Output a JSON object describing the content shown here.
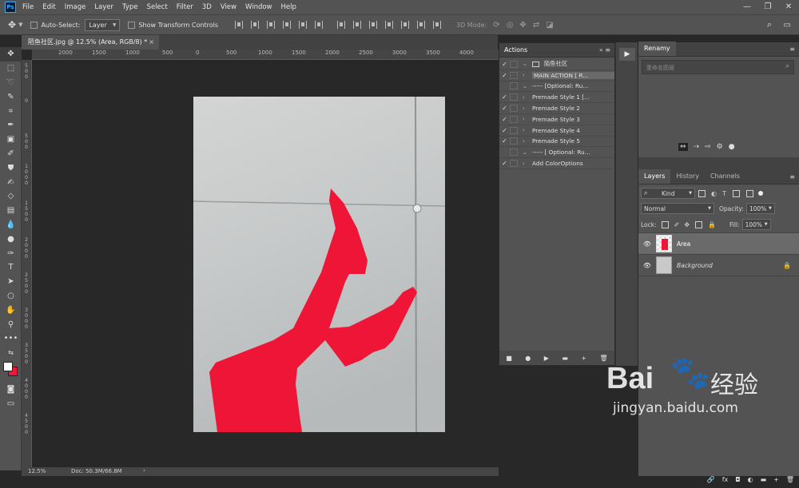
{
  "app": {
    "logo": "Ps"
  },
  "menubar": [
    "File",
    "Edit",
    "Image",
    "Layer",
    "Type",
    "Select",
    "Filter",
    "3D",
    "View",
    "Window",
    "Help"
  ],
  "window_controls": [
    "—",
    "❐",
    "✕"
  ],
  "options_bar": {
    "auto_select_label": "Auto-Select:",
    "auto_select_target": "Layer",
    "transform_label": "Show Transform Controls",
    "mode_3d_label": "3D Mode:"
  },
  "document": {
    "tab_title": "陌鱼社区.jpg @ 12.5% (Area, RGB/8) *",
    "close": "×"
  },
  "ruler_h": [
    "2000",
    "1500",
    "1000",
    "500",
    "0",
    "500",
    "1000",
    "1500",
    "2000",
    "2500",
    "3000",
    "3500",
    "4000"
  ],
  "ruler_v": [
    "5 0 0",
    "0",
    "5 0 0",
    "1 0 0 0",
    "1 5 0 0",
    "2 0 0 0",
    "2 5 0 0",
    "3 0 0 0",
    "3 5 0 0",
    "4 0 0 0",
    "4 5 0 0"
  ],
  "status": {
    "zoom": "12.5%",
    "doc": "Doc: 50.3M/66.8M"
  },
  "actions_panel": {
    "title": "Actions",
    "rows": [
      {
        "check": "✓",
        "dialog": true,
        "arrow": "⌄",
        "label": "陌鱼社区",
        "set": true
      },
      {
        "check": "✓",
        "dialog": true,
        "arrow": "›",
        "label": "MAIN ACTION [ R...",
        "highlight": true
      },
      {
        "check": "",
        "dialog": false,
        "arrow": "⌄",
        "label": "----- [Optional: Ru..."
      },
      {
        "check": "✓",
        "dialog": false,
        "arrow": "›",
        "label": "Premade Style 1 [..."
      },
      {
        "check": "✓",
        "dialog": false,
        "arrow": "›",
        "label": "Premade Style 2"
      },
      {
        "check": "✓",
        "dialog": false,
        "arrow": "›",
        "label": "Premade Style 3"
      },
      {
        "check": "✓",
        "dialog": false,
        "arrow": "›",
        "label": "Premade Style 4"
      },
      {
        "check": "✓",
        "dialog": false,
        "arrow": "›",
        "label": "Premade Style 5"
      },
      {
        "check": "",
        "dialog": false,
        "arrow": "⌄",
        "label": "----- [ Optional: Ru..."
      },
      {
        "check": "✓",
        "dialog": false,
        "arrow": "›",
        "label": "Add ColorOptions"
      }
    ],
    "footer_icons": [
      "■",
      "●",
      "▶",
      "▬",
      "+",
      "🗑"
    ]
  },
  "renamy": {
    "title": "Renamy",
    "placeholder": "重命名图层"
  },
  "layers_panel": {
    "tabs": [
      "Layers",
      "History",
      "Channels"
    ],
    "filter_kind": "Kind",
    "blend_mode": "Normal",
    "opacity_label": "Opacity:",
    "opacity_value": "100%",
    "lock_label": "Lock:",
    "fill_label": "Fill:",
    "fill_value": "100%",
    "layers": [
      {
        "name": "Area",
        "selected": true
      },
      {
        "name": "Background",
        "locked": true
      }
    ],
    "footer_icons": [
      "🔗",
      "fx",
      "◘",
      "◐",
      "▬",
      "+",
      "🗑"
    ]
  },
  "watermark": {
    "brand": "Bai",
    "brand2": "经验",
    "url": "jingyan.baidu.com"
  },
  "colors": {
    "accent_red": "#f0163a",
    "panel": "#535353",
    "dark": "#282828"
  }
}
